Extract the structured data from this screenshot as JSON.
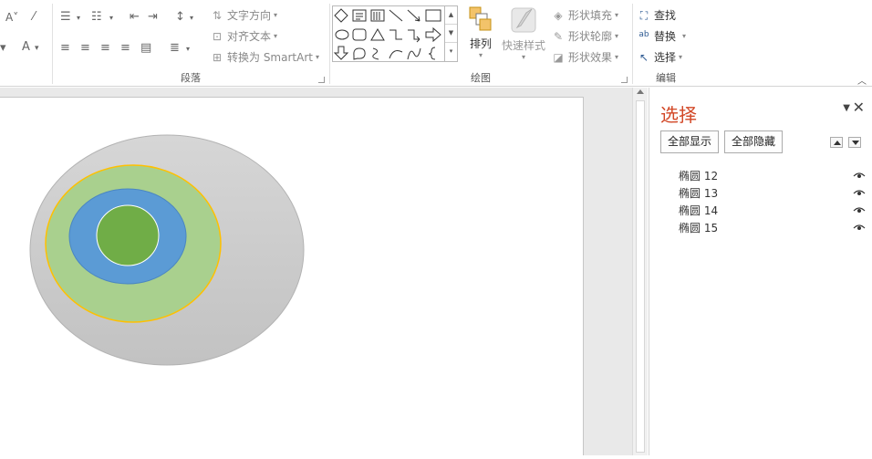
{
  "ribbon": {
    "paragraph_group_label": "段落",
    "drawing_group_label": "绘图",
    "editing_group_label": "编辑",
    "text_direction": "文字方向",
    "align_text": "对齐文本",
    "convert_smartart": "转换为 SmartArt",
    "arrange": "排列",
    "quick_styles": "快速样式",
    "shape_fill": "形状填充",
    "shape_outline": "形状轮廓",
    "shape_effects": "形状效果",
    "find": "查找",
    "replace": "替换",
    "select": "选择",
    "font_a": "A"
  },
  "selection_pane": {
    "title": "选择",
    "show_all": "全部显示",
    "hide_all": "全部隐藏",
    "items": [
      {
        "label": "椭圆 12"
      },
      {
        "label": "椭圆 13"
      },
      {
        "label": "椭圆 14"
      },
      {
        "label": "椭圆 15"
      }
    ]
  },
  "colors": {
    "outer_ellipse": "#cccccc",
    "ring_green": "#a9d08e",
    "ring_outline": "#ffc000",
    "blue": "#5b9bd5",
    "inner_green": "#70ad47",
    "pane_title": "#d24726"
  }
}
